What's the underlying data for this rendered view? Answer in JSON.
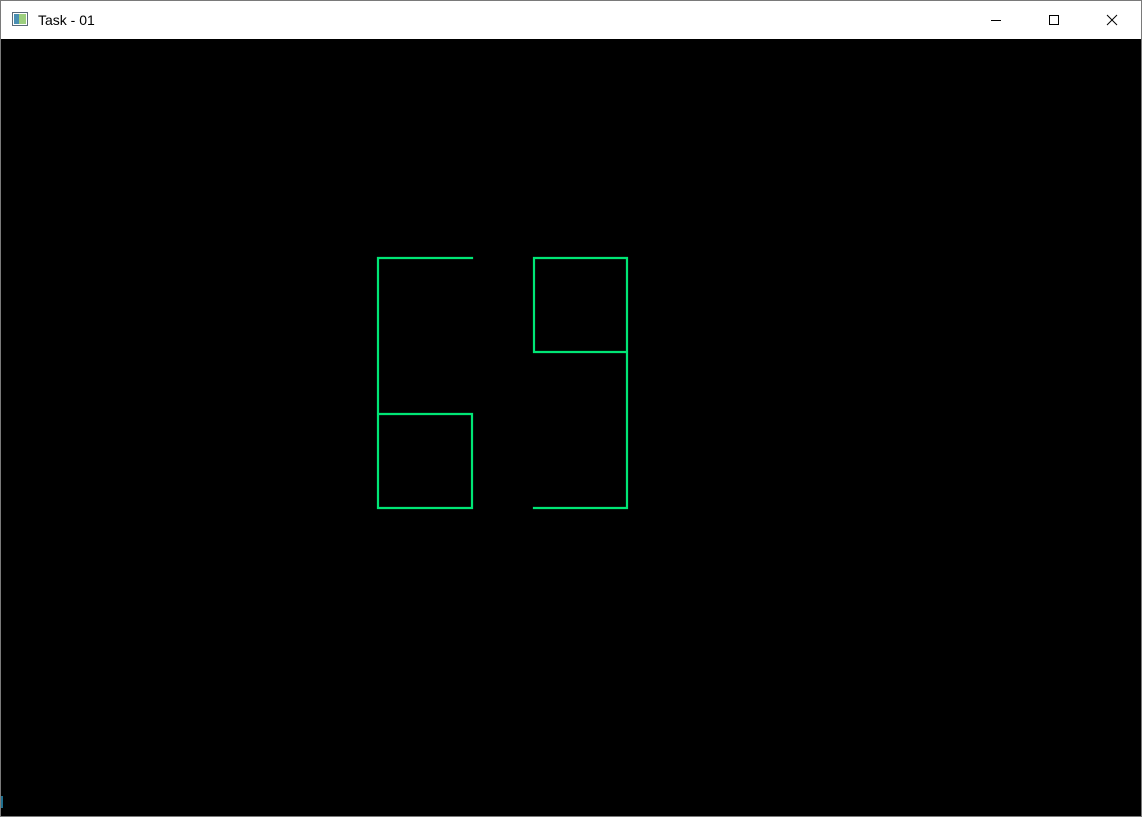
{
  "window": {
    "title": "Task - 01",
    "icon": "app-window-icon",
    "controls": {
      "minimize_icon": "minimize-icon",
      "maximize_icon": "maximize-icon",
      "close_icon": "close-icon"
    }
  },
  "canvas": {
    "background_color": "#000000",
    "stroke_color": "#00e676",
    "displayed_digits": [
      "6",
      "9"
    ]
  }
}
